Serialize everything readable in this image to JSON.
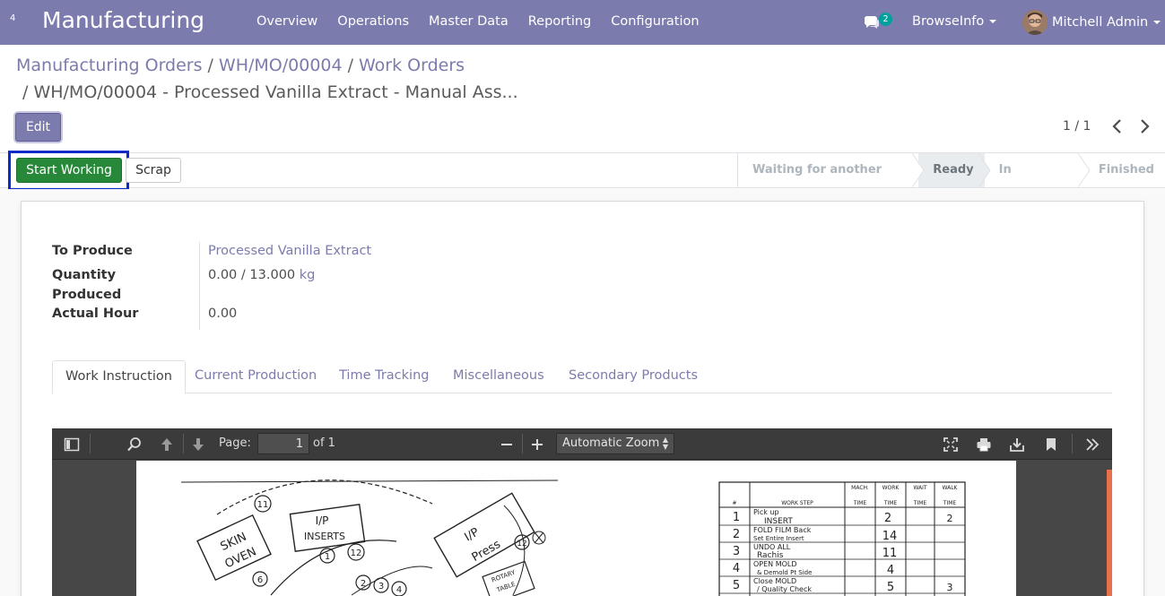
{
  "navbar": {
    "apps_count": "4",
    "brand": "Manufacturing",
    "menu": [
      "Overview",
      "Operations",
      "Master Data",
      "Reporting",
      "Configuration"
    ],
    "chat_count": "2",
    "company": "BrowseInfo",
    "user": "Mitchell Admin"
  },
  "breadcrumb": {
    "item1": "Manufacturing Orders",
    "item2": "WH/MO/00004",
    "item3": "Work Orders",
    "sep": "/",
    "current_sep": "/",
    "current": "WH/MO/00004 - Processed Vanilla Extract - Manual Ass..."
  },
  "controls": {
    "edit_label": "Edit",
    "pager": "1 / 1"
  },
  "statusbar": {
    "start_label": "Start Working",
    "scrap_label": "Scrap",
    "stages": [
      {
        "label": "Waiting for another WO",
        "active": false
      },
      {
        "label": "Ready",
        "active": true
      },
      {
        "label": "In Progress",
        "active": false
      },
      {
        "label": "Finished",
        "active": false
      }
    ]
  },
  "form": {
    "to_produce_label": "To Produce",
    "to_produce_value": "Processed Vanilla Extract",
    "quantity_label_1": "Quantity",
    "quantity_label_2": "Produced",
    "quantity_done": "0.00",
    "quantity_sep": "/",
    "quantity_total": "13.000",
    "quantity_uom": "kg",
    "actual_hour_label": "Actual Hour",
    "actual_hour_value": "0.00"
  },
  "tabs": [
    {
      "label": "Work Instruction",
      "active": true
    },
    {
      "label": "Current Production",
      "active": false
    },
    {
      "label": "Time Tracking",
      "active": false
    },
    {
      "label": "Miscellaneous",
      "active": false
    },
    {
      "label": "Secondary Products",
      "active": false
    }
  ],
  "pdf": {
    "page_label": "Page:",
    "page_value": "1",
    "page_of": "of 1",
    "zoom": "Automatic Zoom",
    "sheet": {
      "labels": [
        "I/P",
        "INSERTS",
        "SKIN",
        "OVEN",
        "I/P",
        "Press",
        "ROTARY",
        "TABLE"
      ],
      "headers": [
        "#",
        "WORK STEP",
        "MACH.",
        "TIME",
        "WORK",
        "TIME",
        "WAIT",
        "TIME",
        "WALK",
        "TIME"
      ],
      "rows": [
        {
          "num": "1",
          "step_a": "Pick up",
          "step_b": "INSERT",
          "work": "2",
          "walk": "2"
        },
        {
          "num": "2",
          "step_a": "FOLD FILM Back",
          "step_b": "Set Entire Insert",
          "work": "14",
          "walk": ""
        },
        {
          "num": "3",
          "step_a": "UNDO ALL",
          "step_b": "Rachis",
          "work": "11",
          "walk": ""
        },
        {
          "num": "4",
          "step_a": "OPEN MOLD",
          "step_b": "& Demold Pt Side",
          "work": "4",
          "walk": ""
        },
        {
          "num": "5",
          "step_a": "Close MOLD",
          "step_b": "/ Quality Check",
          "work": "5",
          "walk": "3"
        }
      ],
      "markers": [
        "11",
        "12",
        "1",
        "2",
        "3",
        "4",
        "6",
        "12"
      ]
    }
  },
  "colors": {
    "brand": "#7c7bad",
    "start_button": "#28883a",
    "focus_outline": "#0b2ac7",
    "chat_badge": "#00a09d"
  }
}
